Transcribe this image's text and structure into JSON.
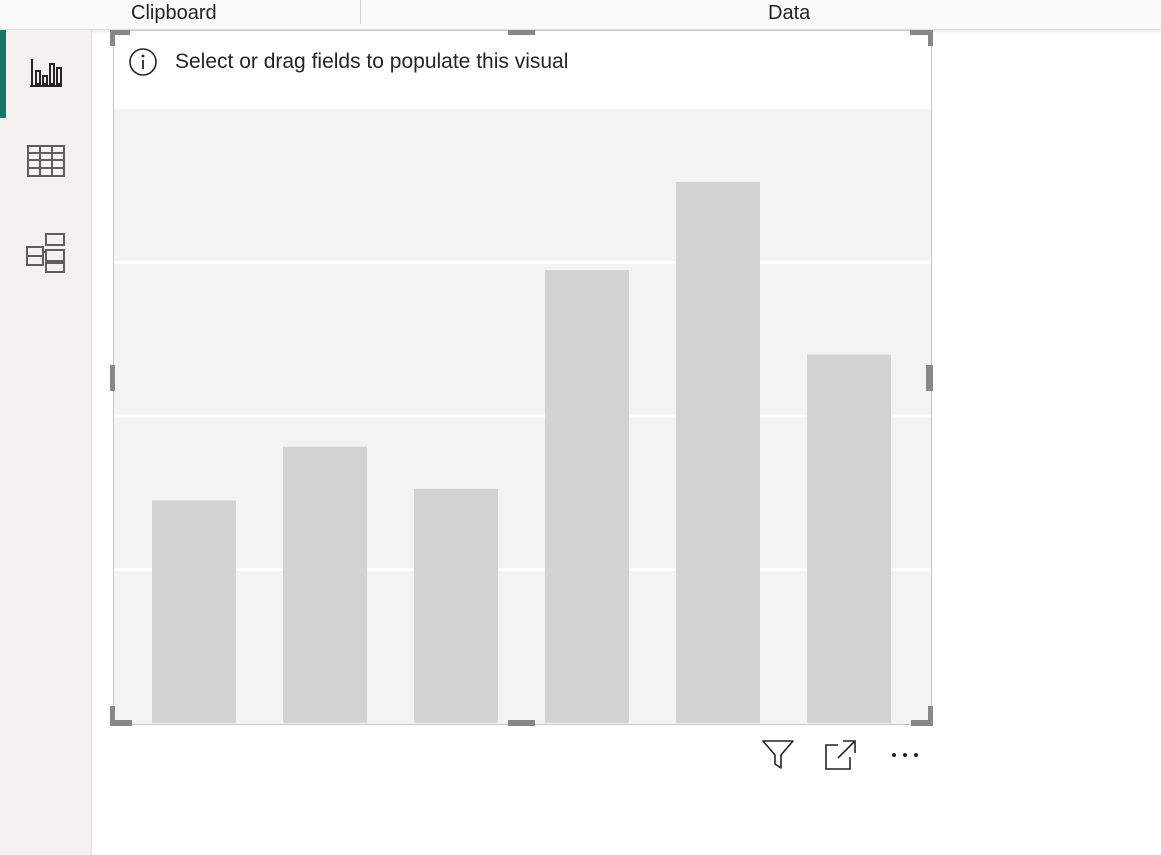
{
  "ribbon": {
    "groups": [
      {
        "label": "Clipboard"
      },
      {
        "label": "Data"
      }
    ]
  },
  "left_rail": {
    "items": [
      {
        "icon": "report-view-icon",
        "active": true
      },
      {
        "icon": "table-view-icon",
        "active": false
      },
      {
        "icon": "model-view-icon",
        "active": false
      }
    ],
    "accent_color": "#117865"
  },
  "visual": {
    "placeholder_text": "Select or drag fields to populate this visual",
    "toolbar": [
      {
        "icon": "filter-icon"
      },
      {
        "icon": "focus-mode-icon"
      },
      {
        "icon": "more-options-icon"
      }
    ]
  },
  "chart_data": {
    "type": "bar",
    "categories": [
      "",
      "",
      "",
      "",
      "",
      ""
    ],
    "values": [
      29,
      36,
      30.5,
      59,
      70.5,
      48
    ],
    "ylim": [
      0,
      80
    ],
    "grid": true,
    "bar_color": "#d2d2d2",
    "background_color": "#f3f3f3"
  }
}
